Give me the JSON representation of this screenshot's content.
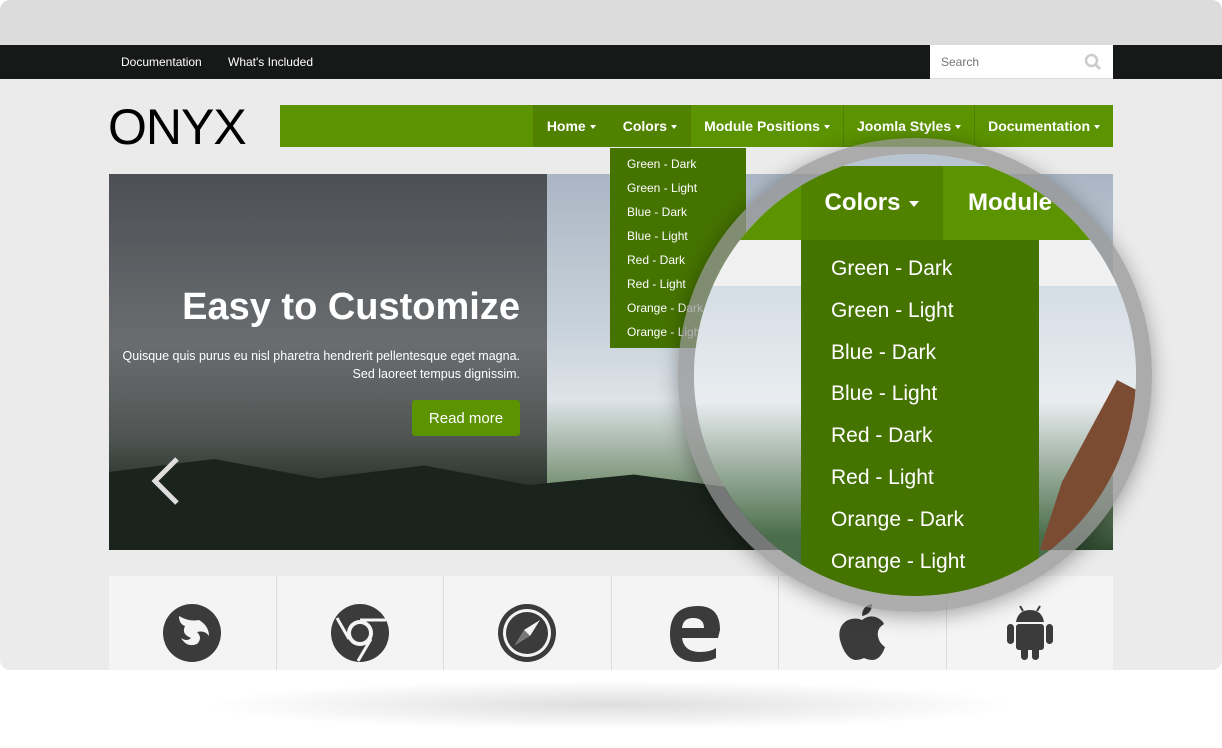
{
  "topbar": {
    "links": [
      "Documentation",
      "What's Included"
    ],
    "search_placeholder": "Search"
  },
  "logo": "ONYX",
  "nav": {
    "items": [
      "Home",
      "Colors",
      "Module Positions",
      "Joomla Styles",
      "Documentation"
    ],
    "active": "Colors"
  },
  "colors_dropdown": [
    "Green - Dark",
    "Green - Light",
    "Blue - Dark",
    "Blue - Light",
    "Red - Dark",
    "Red - Light",
    "Orange - Dark",
    "Orange - Light"
  ],
  "magnifier": {
    "nav_items": [
      "Colors",
      "Module"
    ]
  },
  "slide": {
    "title": "Easy to Customize",
    "text_line1": "Quisque quis purus eu nisl pharetra hendrerit pellentesque eget magna.",
    "text_line2": "Sed laoreet tempus dignissim.",
    "button": "Read more"
  },
  "browser_icons": [
    "firefox-icon",
    "chrome-icon",
    "safari-icon",
    "edge-icon",
    "apple-icon",
    "android-icon"
  ],
  "colors": {
    "accent": "#5c9300",
    "dropdown": "#457300",
    "topbar": "#171918"
  }
}
